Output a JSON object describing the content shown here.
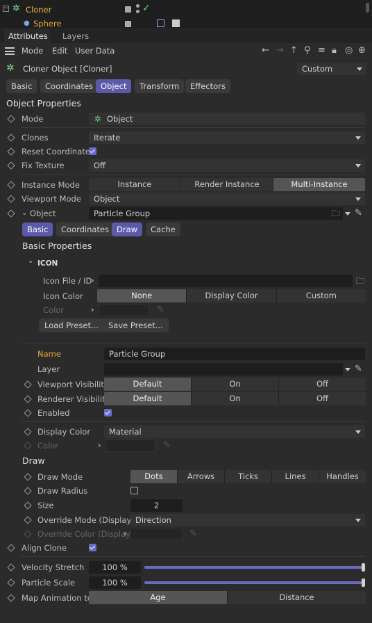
{
  "objects": {
    "row1": "Cloner",
    "row2": "Sphere"
  },
  "tabs": {
    "attributes": "Attributes",
    "layers": "Layers"
  },
  "menu": {
    "mode": "Mode",
    "edit": "Edit",
    "user_data": "User Data"
  },
  "header": {
    "title": "Cloner Object [Cloner]",
    "preset": "Custom"
  },
  "main_tabs": [
    "Basic",
    "Coordinates",
    "Object",
    "Transform",
    "Effectors"
  ],
  "section_title": "Object Properties",
  "props": {
    "mode_label": "Mode",
    "mode_value": "Object",
    "clones_label": "Clones",
    "clones_value": "Iterate",
    "reset_label": "Reset Coordinates",
    "fix_label": "Fix Texture",
    "fix_value": "Off",
    "instance_label": "Instance Mode",
    "instance_options": [
      "Instance",
      "Render Instance",
      "Multi-Instance"
    ],
    "viewport_label": "Viewport Mode",
    "viewport_value": "Object",
    "object_label": "Object",
    "object_value": "Particle Group"
  },
  "sub_tabs": [
    "Basic",
    "Coordinates",
    "Draw",
    "Cache"
  ],
  "basic_props_title": "Basic Properties",
  "icon_section": {
    "title": "ICON",
    "file_label": "Icon File / ID",
    "color_label": "Icon Color",
    "color_options": [
      "None",
      "Display Color",
      "Custom"
    ],
    "color2_label": "Color",
    "load_preset": "Load Preset...",
    "save_preset": "Save Preset..."
  },
  "basic": {
    "name_label": "Name",
    "name_value": "Particle Group",
    "layer_label": "Layer",
    "vp_vis_label": "Viewport Visibility",
    "rd_vis_label": "Renderer Visibility",
    "vis_options": [
      "Default",
      "On",
      "Off"
    ],
    "enabled_label": "Enabled",
    "display_color_label": "Display Color",
    "display_color_value": "Material",
    "color_label": "Color"
  },
  "draw": {
    "title": "Draw",
    "mode_label": "Draw Mode",
    "mode_options": [
      "Dots",
      "Arrows",
      "Ticks",
      "Lines",
      "Handles"
    ],
    "radius_label": "Draw Radius",
    "size_label": "Size",
    "size_value": "2",
    "override_label": "Override Mode (Display)",
    "override_value": "Direction",
    "override_color_label": "Override Color (Display)"
  },
  "align": {
    "label": "Align Clone"
  },
  "velocity": {
    "label": "Velocity Stretch",
    "value": "100 %",
    "fill": 1.0
  },
  "particle_scale": {
    "label": "Particle Scale",
    "value": "100 %",
    "fill": 1.0
  },
  "map_anim": {
    "label": "Map Animation to",
    "options": [
      "Age",
      "Distance"
    ]
  },
  "colors": {
    "accent": "#5a5aa8",
    "name_label": "#e8a33a",
    "cloner": "#e8b84a",
    "check": "#6b6bc8"
  }
}
